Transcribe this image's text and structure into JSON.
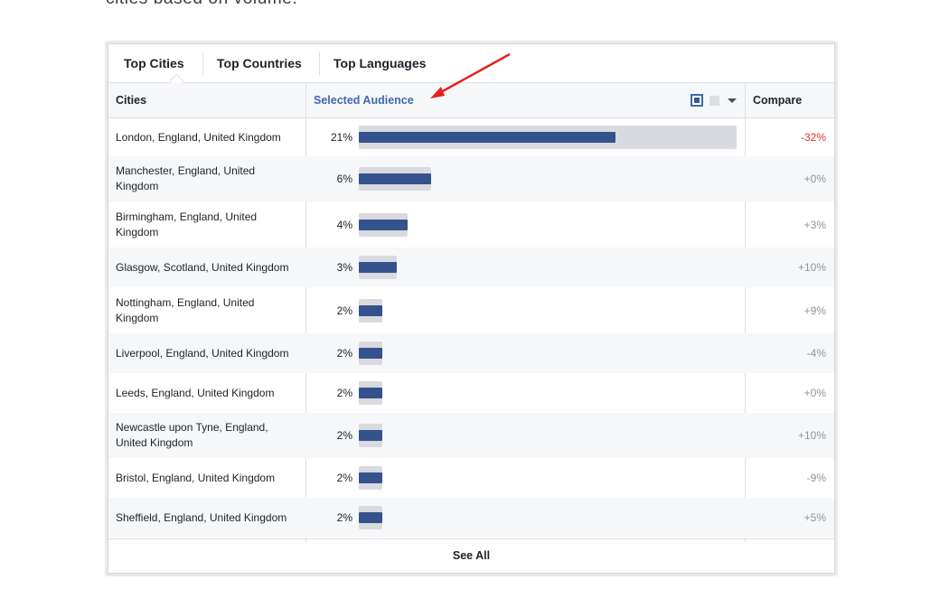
{
  "caption_top": "cities based on volume.",
  "caption_bottom": "",
  "tabs": [
    {
      "label": "Top Cities",
      "active": true
    },
    {
      "label": "Top Countries",
      "active": false
    },
    {
      "label": "Top Languages",
      "active": false
    }
  ],
  "columns": {
    "cities": "Cities",
    "audience": "Selected Audience",
    "compare": "Compare"
  },
  "rows": [
    {
      "city": "London, England, United Kingdom",
      "pct": "21%",
      "value": 21,
      "compare": "-32%"
    },
    {
      "city": "Manchester, England, United Kingdom",
      "pct": "6%",
      "value": 6,
      "compare": "+0%"
    },
    {
      "city": "Birmingham, England, United Kingdom",
      "pct": "4%",
      "value": 4,
      "compare": "+3%"
    },
    {
      "city": "Glasgow, Scotland, United Kingdom",
      "pct": "3%",
      "value": 3,
      "compare": "+10%"
    },
    {
      "city": "Nottingham, England, United Kingdom",
      "pct": "2%",
      "value": 2,
      "compare": "+9%"
    },
    {
      "city": "Liverpool, England, United Kingdom",
      "pct": "2%",
      "value": 2,
      "compare": "-4%"
    },
    {
      "city": "Leeds, England, United Kingdom",
      "pct": "2%",
      "value": 2,
      "compare": "+0%"
    },
    {
      "city": "Newcastle upon Tyne, England, United Kingdom",
      "pct": "2%",
      "value": 2,
      "compare": "+10%"
    },
    {
      "city": "Bristol, England, United Kingdom",
      "pct": "2%",
      "value": 2,
      "compare": "-9%"
    },
    {
      "city": "Sheffield, England, United Kingdom",
      "pct": "2%",
      "value": 2,
      "compare": "+5%"
    }
  ],
  "see_all": "See All",
  "colors": {
    "bar": "#36528c",
    "bar_track": "#d9dadf",
    "link": "#4267b2",
    "negative_highlight": "#e02e2e",
    "annotation_arrow": "#e8201c"
  },
  "icons": {
    "view_toggle_on": "filled-square-icon",
    "view_toggle_off": "gray-square-icon",
    "menu": "caret-down-icon"
  }
}
